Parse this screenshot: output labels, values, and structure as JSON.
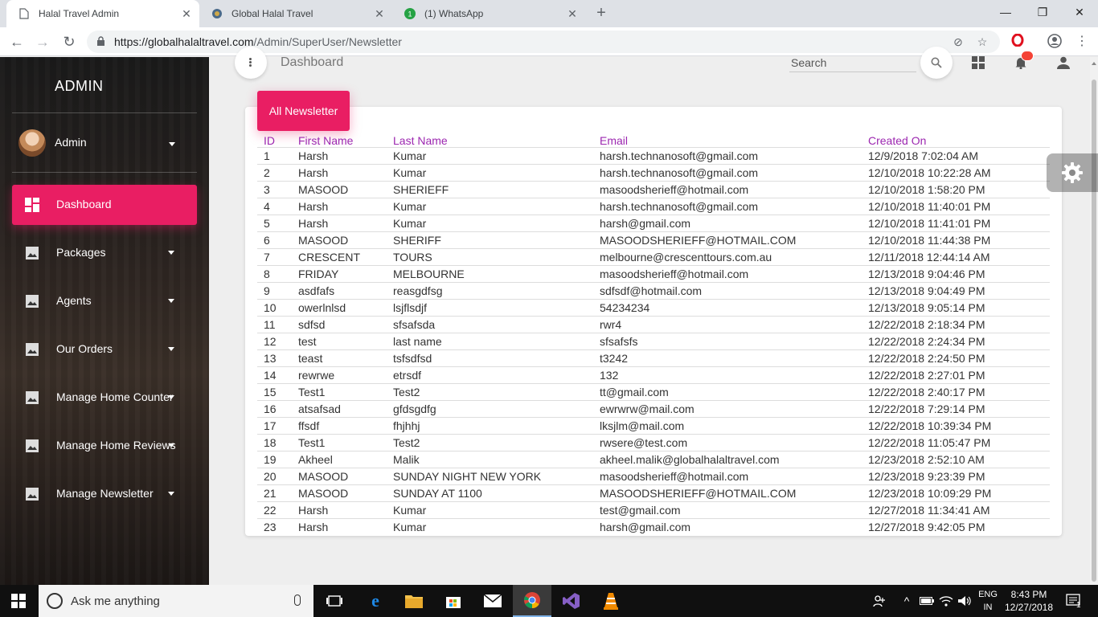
{
  "browser": {
    "tabs": [
      {
        "title": "Halal Travel Admin",
        "active": true
      },
      {
        "title": "Global Halal Travel",
        "active": false
      },
      {
        "title": "(1) WhatsApp",
        "active": false
      }
    ],
    "url_host": "https://globalhalaltravel.com",
    "url_path": "/Admin/SuperUser/Newsletter"
  },
  "sidebar": {
    "brand": "ADMIN",
    "user": "Admin",
    "items": [
      {
        "label": "Dashboard",
        "active": true
      },
      {
        "label": "Packages"
      },
      {
        "label": "Agents"
      },
      {
        "label": "Our Orders"
      },
      {
        "label": "Manage Home Counter"
      },
      {
        "label": "Manage Home Reviews"
      },
      {
        "label": "Manage Newsletter"
      }
    ]
  },
  "topbar": {
    "title": "Dashboard",
    "search_placeholder": "Search"
  },
  "card": {
    "title": "All Newsletter",
    "columns": [
      "ID",
      "First Name",
      "Last Name",
      "Email",
      "Created On"
    ],
    "rows": [
      [
        "1",
        "Harsh",
        "Kumar",
        "harsh.technanosoft@gmail.com",
        "12/9/2018 7:02:04 AM"
      ],
      [
        "2",
        "Harsh",
        "Kumar",
        "harsh.technanosoft@gmail.com",
        "12/10/2018 10:22:28 AM"
      ],
      [
        "3",
        "MASOOD",
        "SHERIEFF",
        "masoodsherieff@hotmail.com",
        "12/10/2018 1:58:20 PM"
      ],
      [
        "4",
        "Harsh",
        "Kumar",
        "harsh.technanosoft@gmail.com",
        "12/10/2018 11:40:01 PM"
      ],
      [
        "5",
        "Harsh",
        "Kumar",
        "harsh@gmail.com",
        "12/10/2018 11:41:01 PM"
      ],
      [
        "6",
        "MASOOD",
        "SHERIFF",
        "MASOODSHERIEFF@HOTMAIL.COM",
        "12/10/2018 11:44:38 PM"
      ],
      [
        "7",
        "CRESCENT",
        "TOURS",
        "melbourne@crescenttours.com.au",
        "12/11/2018 12:44:14 AM"
      ],
      [
        "8",
        "FRIDAY",
        "MELBOURNE",
        "masoodsherieff@hotmail.com",
        "12/13/2018 9:04:46 PM"
      ],
      [
        "9",
        "asdfafs",
        "reasgdfsg",
        "sdfsdf@hotmail.com",
        "12/13/2018 9:04:49 PM"
      ],
      [
        "10",
        "owerlnlsd",
        "lsjflsdjf",
        "54234234",
        "12/13/2018 9:05:14 PM"
      ],
      [
        "11",
        "sdfsd",
        "sfsafsda",
        "rwr4",
        "12/22/2018 2:18:34 PM"
      ],
      [
        "12",
        "test",
        "last name",
        "sfsafsfs",
        "12/22/2018 2:24:34 PM"
      ],
      [
        "13",
        "teast",
        "tsfsdfsd",
        "t3242",
        "12/22/2018 2:24:50 PM"
      ],
      [
        "14",
        "rewrwe",
        "etrsdf",
        "132",
        "12/22/2018 2:27:01 PM"
      ],
      [
        "15",
        "Test1",
        "Test2",
        "tt@gmail.com",
        "12/22/2018 2:40:17 PM"
      ],
      [
        "16",
        "atsafsad",
        "gfdsgdfg",
        "ewrwrw@mail.com",
        "12/22/2018 7:29:14 PM"
      ],
      [
        "17",
        "ffsdf",
        "fhjhhj",
        "lksjlm@mail.com",
        "12/22/2018 10:39:34 PM"
      ],
      [
        "18",
        "Test1",
        "Test2",
        "rwsere@test.com",
        "12/22/2018 11:05:47 PM"
      ],
      [
        "19",
        "Akheel",
        "Malik",
        "akheel.malik@globalhalaltravel.com",
        "12/23/2018 2:52:10 AM"
      ],
      [
        "20",
        "MASOOD",
        "SUNDAY NIGHT NEW YORK",
        "masoodsherieff@hotmail.com",
        "12/23/2018 9:23:39 PM"
      ],
      [
        "21",
        "MASOOD",
        "SUNDAY AT 1100",
        "MASOODSHERIEFF@HOTMAIL.COM",
        "12/23/2018 10:09:29 PM"
      ],
      [
        "22",
        "Harsh",
        "Kumar",
        "test@gmail.com",
        "12/27/2018 11:34:41 AM"
      ],
      [
        "23",
        "Harsh",
        "Kumar",
        "harsh@gmail.com",
        "12/27/2018 9:42:05 PM"
      ]
    ]
  },
  "taskbar": {
    "search_placeholder": "Ask me anything",
    "lang_top": "ENG",
    "lang_bottom": "IN",
    "time": "8:43 PM",
    "date": "12/27/2018",
    "notifications": "1"
  },
  "colors": {
    "accent": "#e91e63",
    "header_text": "#9c27b0",
    "sidebar_bg": "#2a2320"
  }
}
